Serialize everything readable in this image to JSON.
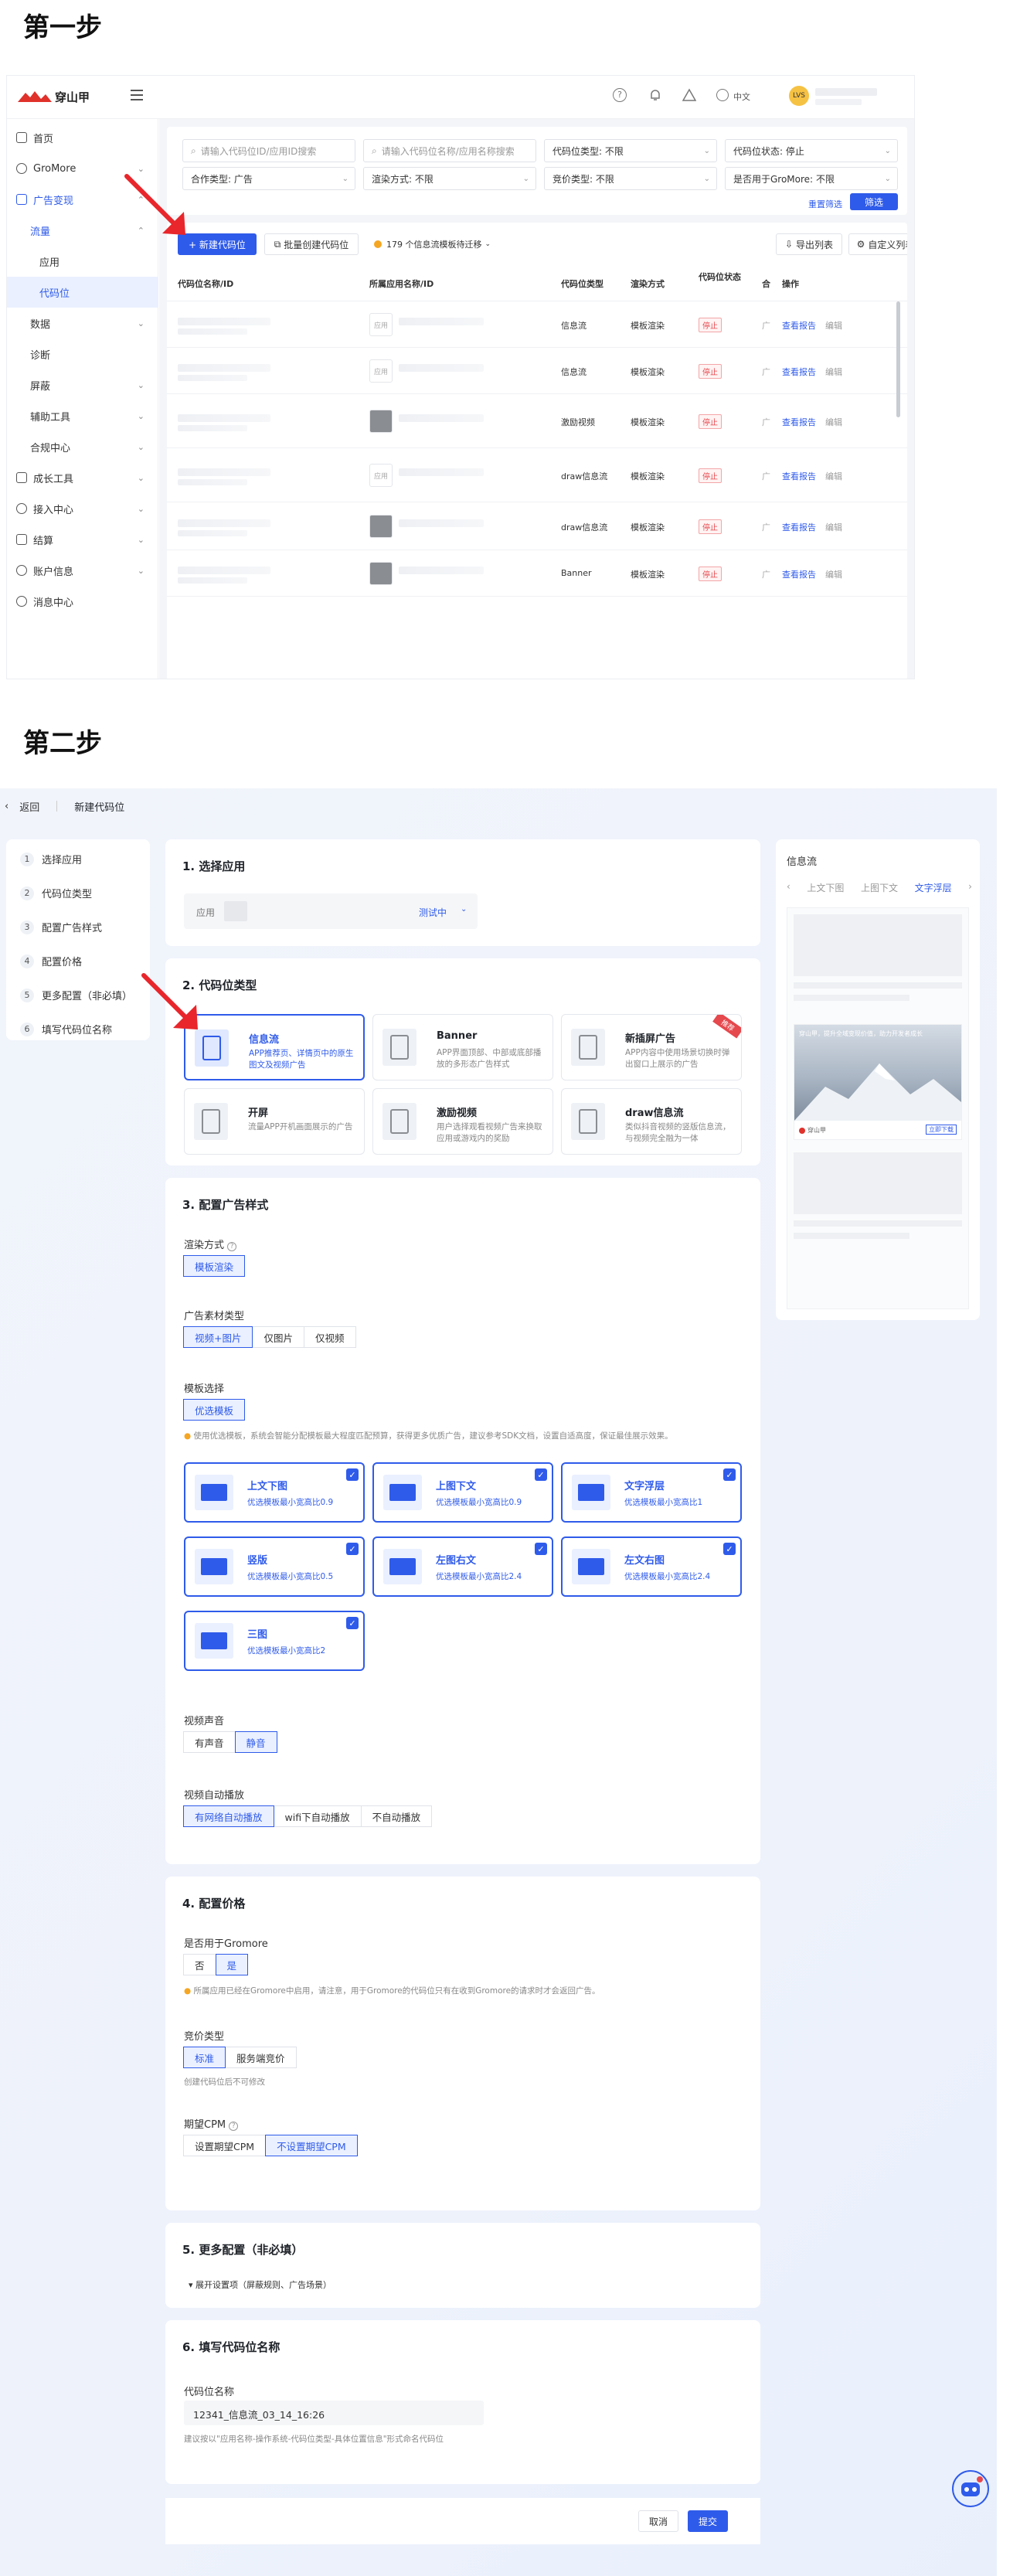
{
  "step1_title": "第一步",
  "step2_title": "第二步",
  "s1": {
    "logo_text": "穿山甲",
    "top_lang": "中文",
    "user_initials": "LVS",
    "sidebar": {
      "home": "首页",
      "gromore": "GroMore",
      "ad_monetize": "广告变现",
      "traffic": "流量",
      "app": "应用",
      "adslot": "代码位",
      "data": "数据",
      "diagnose": "诊断",
      "block": "屏蔽",
      "tools": "辅助工具",
      "compliance": "合规中心",
      "growth": "成长工具",
      "access": "接入中心",
      "settle": "结算",
      "account": "账户信息",
      "message": "消息中心"
    },
    "filters": {
      "search1_placeholder": "请输入代码位ID/应用ID搜索",
      "search2_placeholder": "请输入代码位名称/应用名称搜索",
      "slot_type": "代码位类型:",
      "slot_type_v": "不限",
      "slot_status": "代码位状态:",
      "slot_status_v": "停止",
      "coop": "合作类型:",
      "coop_v": "广告",
      "render": "渲染方式:",
      "render_v": "不限",
      "bid": "竞价类型:",
      "bid_v": "不限",
      "gromore": "是否用于GroMore:",
      "gromore_v": "不限",
      "reset": "重置筛选",
      "filter": "筛选"
    },
    "toolbar": {
      "new": "+ 新建代码位",
      "batch": "批量创建代码位",
      "notice": "179 个信息流模板待迁移",
      "export": "导出列表",
      "custom_cols": "自定义列表"
    },
    "headers": [
      "代码位名称/ID",
      "所属应用名称/ID",
      "代码位类型",
      "渲染方式",
      "代码位状态",
      "合",
      "操作"
    ],
    "rows": [
      {
        "app_tag": "应用",
        "type": "信息流",
        "render": "模板渲染",
        "status": "停止",
        "view": "查看报告",
        "edit": "编辑"
      },
      {
        "app_tag": "应用",
        "type": "信息流",
        "render": "模板渲染",
        "status": "停止",
        "view": "查看报告",
        "edit": "编辑"
      },
      {
        "app_tag": "",
        "type": "激励视频",
        "render": "模板渲染",
        "status": "停止",
        "view": "查看报告",
        "edit": "编辑"
      },
      {
        "app_tag": "应用",
        "type": "draw信息流",
        "render": "模板渲染",
        "status": "停止",
        "view": "查看报告",
        "edit": "编辑"
      },
      {
        "app_tag": "",
        "type": "draw信息流",
        "render": "模板渲染",
        "status": "停止",
        "view": "查看报告",
        "edit": "编辑"
      },
      {
        "app_tag": "",
        "type": "Banner",
        "render": "模板渲染",
        "status": "停止",
        "view": "查看报告",
        "edit": "编辑"
      }
    ]
  },
  "s2": {
    "back": "返回",
    "page_title": "新建代码位",
    "steps": [
      "选择应用",
      "代码位类型",
      "配置广告样式",
      "配置价格",
      "更多配置（非必填）",
      "填写代码位名称"
    ],
    "sec1": {
      "title": "1. 选择应用",
      "app_label": "应用",
      "app_status": "测试中"
    },
    "sec2": {
      "title": "2. 代码位类型",
      "cards": [
        {
          "name": "信息流",
          "desc": "APP推荐页、详情页中的原生图文及视频广告"
        },
        {
          "name": "Banner",
          "desc": "APP界面顶部、中部或底部播放的多形态广告样式"
        },
        {
          "name": "新插屏广告",
          "desc": "APP内容中使用场景切换时弹出窗口上展示的广告",
          "badge": "推荐"
        },
        {
          "name": "开屏",
          "desc": "流量APP开机画面展示的广告"
        },
        {
          "name": "激励视频",
          "desc": "用户选择观看视频广告来换取应用或游戏内的奖励"
        },
        {
          "name": "draw信息流",
          "desc": "类似抖音视频的竖版信息流，与视频完全融为一体"
        }
      ]
    },
    "sec3": {
      "title": "3. 配置广告样式",
      "render_label": "渲染方式",
      "render_opt": "模板渲染",
      "material_label": "广告素材类型",
      "material_opts": [
        "视频+图片",
        "仅图片",
        "仅视频"
      ],
      "template_label": "模板选择",
      "template_opt": "优选模板",
      "template_hint": "使用优选模板，系统会智能分配模板最大程度匹配预算，获得更多优质广告，建议参考SDK文档，设置自适高度，保证最佳展示效果。",
      "templates": [
        {
          "name": "上文下图",
          "desc": "优选模板最小宽高比0.9"
        },
        {
          "name": "上图下文",
          "desc": "优选模板最小宽高比0.9"
        },
        {
          "name": "文字浮层",
          "desc": "优选模板最小宽高比1"
        },
        {
          "name": "竖版",
          "desc": "优选模板最小宽高比0.5"
        },
        {
          "name": "左图右文",
          "desc": "优选模板最小宽高比2.4"
        },
        {
          "name": "左文右图",
          "desc": "优选模板最小宽高比2.4"
        },
        {
          "name": "三图",
          "desc": "优选模板最小宽高比2"
        }
      ],
      "sound_label": "视频声音",
      "sound_opts": [
        "有声音",
        "静音"
      ],
      "autoplay_label": "视频自动播放",
      "autoplay_opts": [
        "有网络自动播放",
        "wifi下自动播放",
        "不自动播放"
      ]
    },
    "sec4": {
      "title": "4. 配置价格",
      "gromore_label": "是否用于Gromore",
      "gromore_opts": [
        "否",
        "是"
      ],
      "gromore_hint": "所属应用已经在Gromore中启用，请注意，用于Gromore的代码位只有在收到Gromore的请求时才会返回广告。",
      "bid_label": "竞价类型",
      "bid_opts": [
        "标准",
        "服务端竞价"
      ],
      "bid_hint": "创建代码位后不可修改",
      "cpm_label": "期望CPM",
      "cpm_opts": [
        "设置期望CPM",
        "不设置期望CPM"
      ]
    },
    "sec5": {
      "title": "5. 更多配置（非必填）",
      "expand": "展开设置项（屏蔽规则、广告场景）"
    },
    "sec6": {
      "title": "6. 填写代码位名称",
      "name_label": "代码位名称",
      "name_value": "12341_信息流_03_14_16:26",
      "name_hint": "建议按以\"应用名称-操作系统-代码位类型-具体位置信息\"形式命名代码位"
    },
    "footer": {
      "cancel": "取消",
      "submit": "提交"
    },
    "preview": {
      "title": "信息流",
      "tabs": [
        "上文下图",
        "上图下文",
        "文字浮层"
      ],
      "ad_text": "穿山甲，提升全域变现价值，助力开发者成长",
      "ad_brand": "穿山甲",
      "ad_btn": "立即下载"
    }
  }
}
